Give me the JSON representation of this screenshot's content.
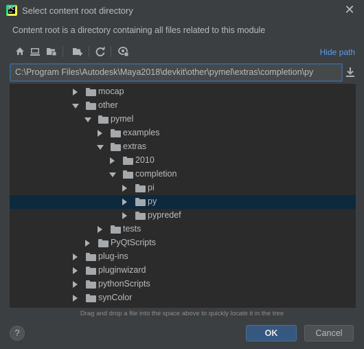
{
  "window": {
    "title": "Select content root directory",
    "description": "Content root is a directory containing all files related to this module"
  },
  "toolbar": {
    "buttons": [
      {
        "name": "home-icon"
      },
      {
        "name": "desktop-icon"
      },
      {
        "name": "project-folder-icon"
      },
      {
        "name": "new-folder-icon"
      },
      {
        "name": "refresh-icon"
      },
      {
        "name": "show-hidden-icon"
      }
    ],
    "hide_path_label": "Hide path"
  },
  "path": {
    "value": "C:\\Program Files\\Autodesk\\Maya2018\\devkit\\other\\pymel\\extras\\completion\\py"
  },
  "tree": {
    "rows": [
      {
        "label": "mocap",
        "expanded": false,
        "depth": 0
      },
      {
        "label": "other",
        "expanded": true,
        "depth": 0
      },
      {
        "label": "pymel",
        "expanded": true,
        "depth": 1
      },
      {
        "label": "examples",
        "expanded": false,
        "depth": 2
      },
      {
        "label": "extras",
        "expanded": true,
        "depth": 2
      },
      {
        "label": "2010",
        "expanded": false,
        "depth": 3
      },
      {
        "label": "completion",
        "expanded": true,
        "depth": 3
      },
      {
        "label": "pi",
        "expanded": false,
        "depth": 4
      },
      {
        "label": "py",
        "expanded": false,
        "depth": 4,
        "selected": true
      },
      {
        "label": "pypredef",
        "expanded": false,
        "depth": 4
      },
      {
        "label": "tests",
        "expanded": false,
        "depth": 2
      },
      {
        "label": "PyQtScripts",
        "expanded": false,
        "depth": 1
      },
      {
        "label": "plug-ins",
        "expanded": false,
        "depth": 0
      },
      {
        "label": "pluginwizard",
        "expanded": false,
        "depth": 0
      },
      {
        "label": "pythonScripts",
        "expanded": false,
        "depth": 0
      },
      {
        "label": "synColor",
        "expanded": false,
        "depth": 0
      }
    ]
  },
  "hint": "Drag and drop a file into the space above to quickly locate it in the tree",
  "footer": {
    "help_label": "?",
    "ok_label": "OK",
    "cancel_label": "Cancel"
  },
  "colors": {
    "background": "#3c3f41",
    "tree_background": "#2b2b2b",
    "selection": "#0d293e",
    "link": "#589df6",
    "ok_button": "#365880"
  }
}
